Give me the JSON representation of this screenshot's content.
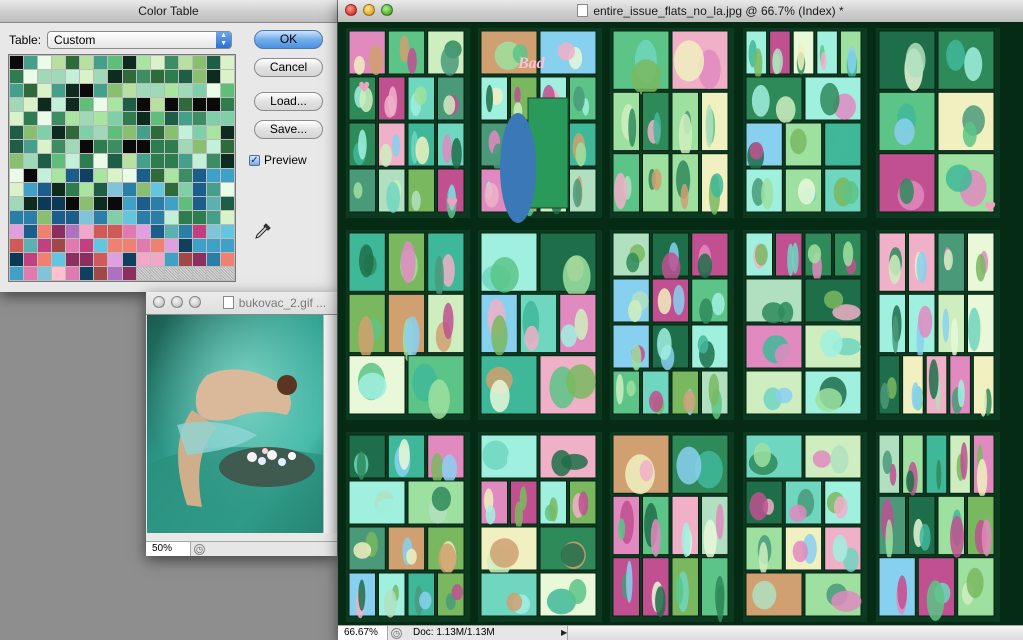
{
  "color_table_dialog": {
    "title": "Color Table",
    "table_label": "Table:",
    "table_value": "Custom",
    "buttons": {
      "ok": "OK",
      "cancel": "Cancel",
      "load": "Load...",
      "save": "Save..."
    },
    "preview_label": "Preview",
    "preview_checked": true
  },
  "small_window": {
    "title": "bukovac_2.gif ...",
    "zoom": "50%"
  },
  "main_window": {
    "title": "entire_issue_flats_no_la.jpg @ 66.7% (Index) *",
    "zoom": "66.67%",
    "doc_info": "Doc: 1.13M/1.13M"
  },
  "page_annotations": {
    "speech_bubble": "Bad"
  },
  "colors": {
    "canvas_background": "#062b15",
    "desktop_background": "#8e8e8e",
    "accent_blue": "#4b8fe0"
  }
}
